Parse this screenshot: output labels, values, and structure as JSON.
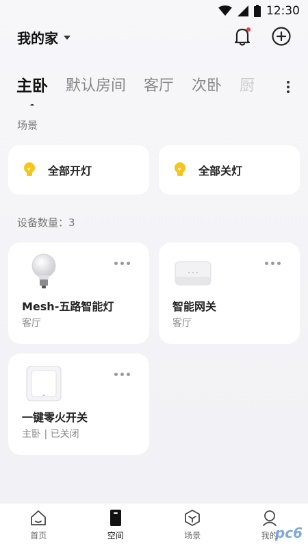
{
  "status_bar": {
    "time": "12:30"
  },
  "header": {
    "home_title": "我的家",
    "bell_icon": "bell-icon",
    "add_icon": "plus-circle-icon",
    "notification_color": "#f04040"
  },
  "tabs": [
    {
      "label": "主卧",
      "active": true
    },
    {
      "label": "默认房间"
    },
    {
      "label": "客厅"
    },
    {
      "label": "次卧"
    },
    {
      "label": "厨"
    }
  ],
  "scenes": {
    "label": "场景",
    "items": [
      {
        "name": "全部开灯",
        "icon": "bulb-icon"
      },
      {
        "name": "全部关灯",
        "icon": "bulb-icon"
      }
    ]
  },
  "devices": {
    "label": "设备数量：3",
    "items": [
      {
        "name": "Mesh-五路智能灯",
        "room": "客厅",
        "icon": "light-bulb-icon"
      },
      {
        "name": "智能网关",
        "room": "客厅",
        "icon": "gateway-icon"
      },
      {
        "name": "一键零火开关",
        "room": "主卧 | 已关闭",
        "icon": "wall-switch-icon"
      }
    ]
  },
  "bottom_nav": [
    {
      "label": "首页",
      "icon": "home-icon"
    },
    {
      "label": "空间",
      "icon": "space-icon",
      "active": true
    },
    {
      "label": "场景",
      "icon": "scene-cube-icon"
    },
    {
      "label": "我的",
      "icon": "profile-icon"
    }
  ],
  "colors": {
    "accent_yellow": "#f5c518",
    "background": "#f2f2f6"
  }
}
